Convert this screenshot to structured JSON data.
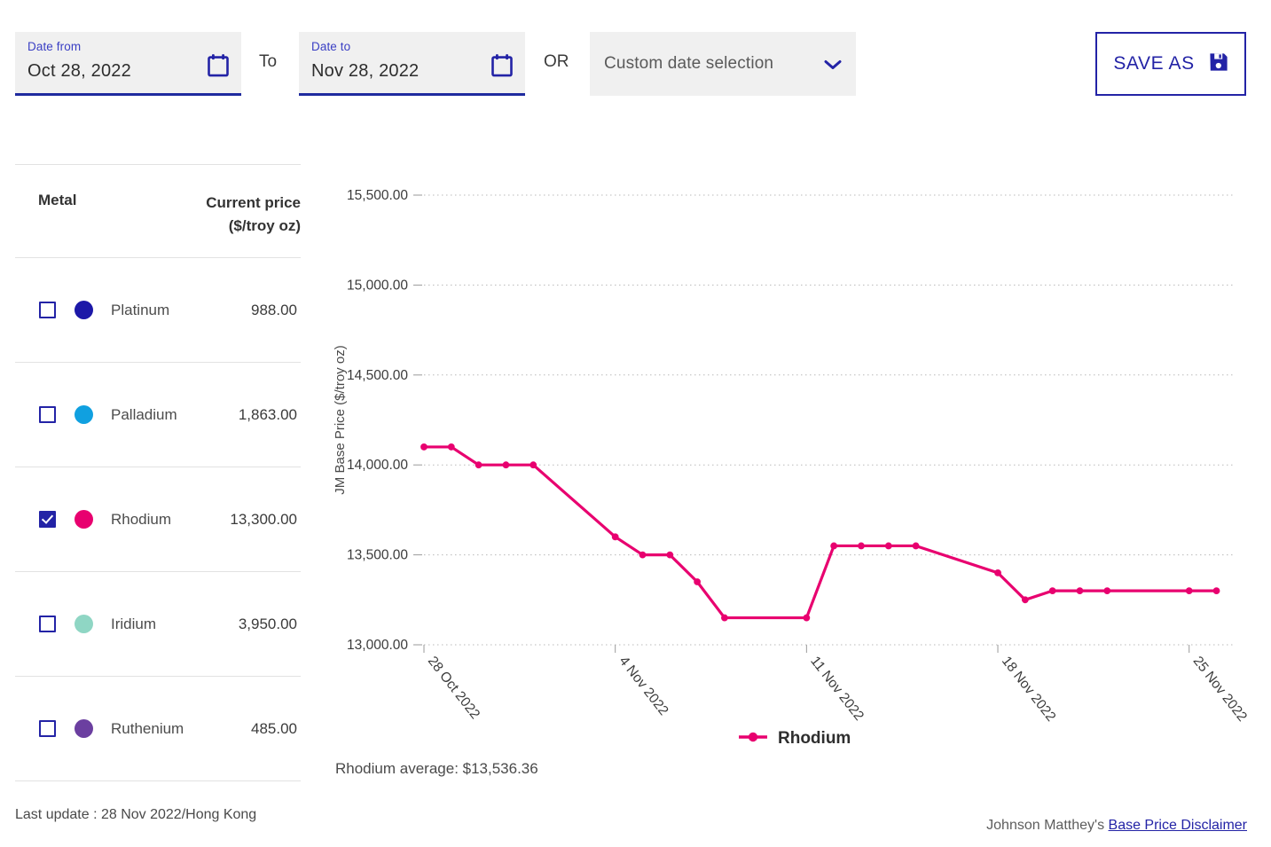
{
  "toolbar": {
    "date_from": {
      "label": "Date from",
      "value": "Oct 28, 2022",
      "icon": "calendar-icon"
    },
    "to_separator": "To",
    "date_to": {
      "label": "Date to",
      "value": "Nov 28, 2022",
      "icon": "calendar-icon"
    },
    "or_separator": "OR",
    "custom_date_select": {
      "value": "Custom date selection",
      "icon": "chevron-down-icon"
    },
    "save_as": {
      "label": "SAVE AS",
      "icon": "save-disk-icon"
    },
    "accent_color": "#2323a6"
  },
  "metal_table": {
    "headers": {
      "metal": "Metal",
      "price": "Current price",
      "price_unit": "($/troy oz)"
    },
    "rows": [
      {
        "name": "Platinum",
        "price": "988.00",
        "color": "#1c18a8",
        "checked": false
      },
      {
        "name": "Palladium",
        "price": "1,863.00",
        "color": "#10a0e0",
        "checked": false
      },
      {
        "name": "Rhodium",
        "price": "13,300.00",
        "color": "#e8006f",
        "checked": true
      },
      {
        "name": "Iridium",
        "price": "3,950.00",
        "color": "#8fd6c4",
        "checked": false
      },
      {
        "name": "Ruthenium",
        "price": "485.00",
        "color": "#6b3fa0",
        "checked": false
      }
    ],
    "last_update": "Last update : 28 Nov 2022/Hong Kong"
  },
  "chart_data": {
    "type": "line",
    "title": "",
    "xlabel": "",
    "ylabel": "JM Base Price ($/troy oz)",
    "ylim": [
      13000,
      15500
    ],
    "ytick_labels": [
      "15,500.00",
      "15,000.00",
      "14,500.00",
      "14,000.00",
      "13,500.00",
      "13,000.00"
    ],
    "ytick_values": [
      15500,
      15000,
      14500,
      14000,
      13500,
      13000
    ],
    "xtick_labels": [
      "28 Oct 2022",
      "4 Nov 2022",
      "11 Nov 2022",
      "18 Nov 2022",
      "25 Nov 2022"
    ],
    "xtick_days": [
      0,
      7,
      14,
      21,
      28
    ],
    "grid": true,
    "legend_position": "bottom",
    "series": [
      {
        "name": "Rhodium",
        "color": "#e8006f",
        "x_days": [
          0,
          1,
          2,
          3,
          4,
          7,
          8,
          9,
          10,
          11,
          14,
          15,
          16,
          17,
          18,
          21,
          22,
          23,
          24,
          25,
          28,
          29
        ],
        "values": [
          14100,
          14100,
          14000,
          14000,
          14000,
          13600,
          13500,
          13500,
          13350,
          13150,
          13150,
          13550,
          13550,
          13550,
          13550,
          13400,
          13250,
          13300,
          13300,
          13300,
          13300,
          13300
        ]
      }
    ],
    "legend": [
      {
        "label": "Rhodium",
        "color": "#e8006f"
      }
    ],
    "average_text": "Rhodium average: $13,536.36"
  },
  "footer": {
    "disclaimer_prefix": "Johnson Matthey's ",
    "disclaimer_link": "Base Price Disclaimer"
  }
}
